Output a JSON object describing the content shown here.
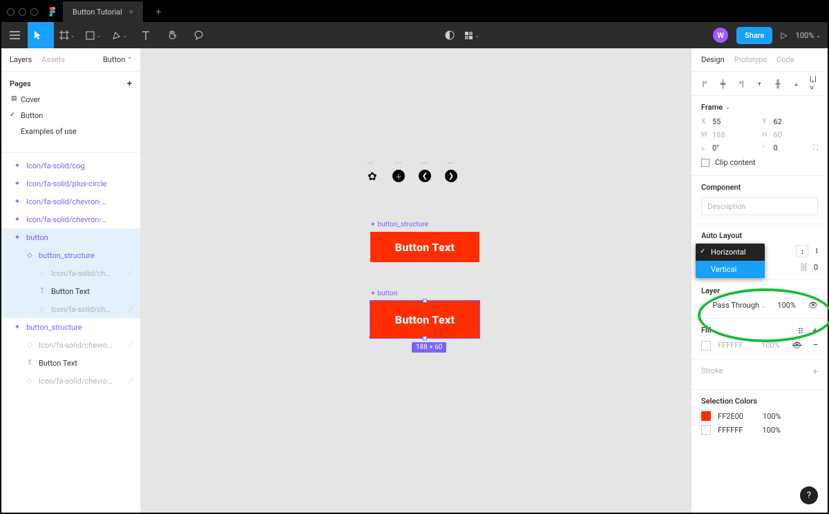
{
  "titlebar": {
    "tab_name": "Button Tutorial"
  },
  "toolbar": {
    "avatar_initial": "W",
    "share_label": "Share",
    "zoom": "100%"
  },
  "left_panel": {
    "tabs": {
      "layers": "Layers",
      "assets": "Assets",
      "page_sel": "Button"
    },
    "pages_header": "Pages",
    "pages": [
      "Cover",
      "Button",
      "Examples of use"
    ],
    "layers": [
      {
        "name": "Icon/fa-solid/cog"
      },
      {
        "name": "Icon/fa-solid/plus-circle"
      },
      {
        "name": "Icon/fa-solid/chevron-circle-left"
      },
      {
        "name": "Icon/fa-solid/chevron-circle-right"
      },
      {
        "name": "button"
      },
      {
        "name": "button_structure"
      },
      {
        "name": "Icon/fa-solid/ch…"
      },
      {
        "name": "Button Text"
      },
      {
        "name": "Icon/fa-solid/ch…"
      },
      {
        "name": "button_structure"
      },
      {
        "name": "Icon/fa-solid/chevro…"
      },
      {
        "name": "Button Text"
      },
      {
        "name": "Icon/fa-solid/chevro…"
      }
    ]
  },
  "canvas": {
    "label1": "button_structure",
    "label2": "button",
    "button_text": "Button Text",
    "size_badge": "188 × 60"
  },
  "right_panel": {
    "tabs": {
      "design": "Design",
      "prototype": "Prototype",
      "code": "Code"
    },
    "frame": {
      "title": "Frame",
      "x_lbl": "X",
      "x": "55",
      "y_lbl": "Y",
      "y": "62",
      "w_lbl": "W",
      "w": "188",
      "h_lbl": "H",
      "h": "60",
      "rot": "0°",
      "rad": "0",
      "clip": "Clip content"
    },
    "component": {
      "title": "Component",
      "placeholder": "Description"
    },
    "auto_layout": {
      "title": "Auto Layout",
      "opt_h": "Horizontal",
      "opt_v": "Vertical",
      "spacing_val": "0"
    },
    "layer": {
      "title": "Layer",
      "blend": "Pass Through",
      "opacity": "100%"
    },
    "fill": {
      "title": "Fill",
      "hex": "FFFFFF",
      "opacity": "100%"
    },
    "stroke": {
      "title": "Stroke"
    },
    "selection_colors": {
      "title": "Selection Colors",
      "c1_hex": "FF2E00",
      "c1_pct": "100%",
      "c2_hex": "FFFFFF",
      "c2_pct": "100%"
    }
  }
}
